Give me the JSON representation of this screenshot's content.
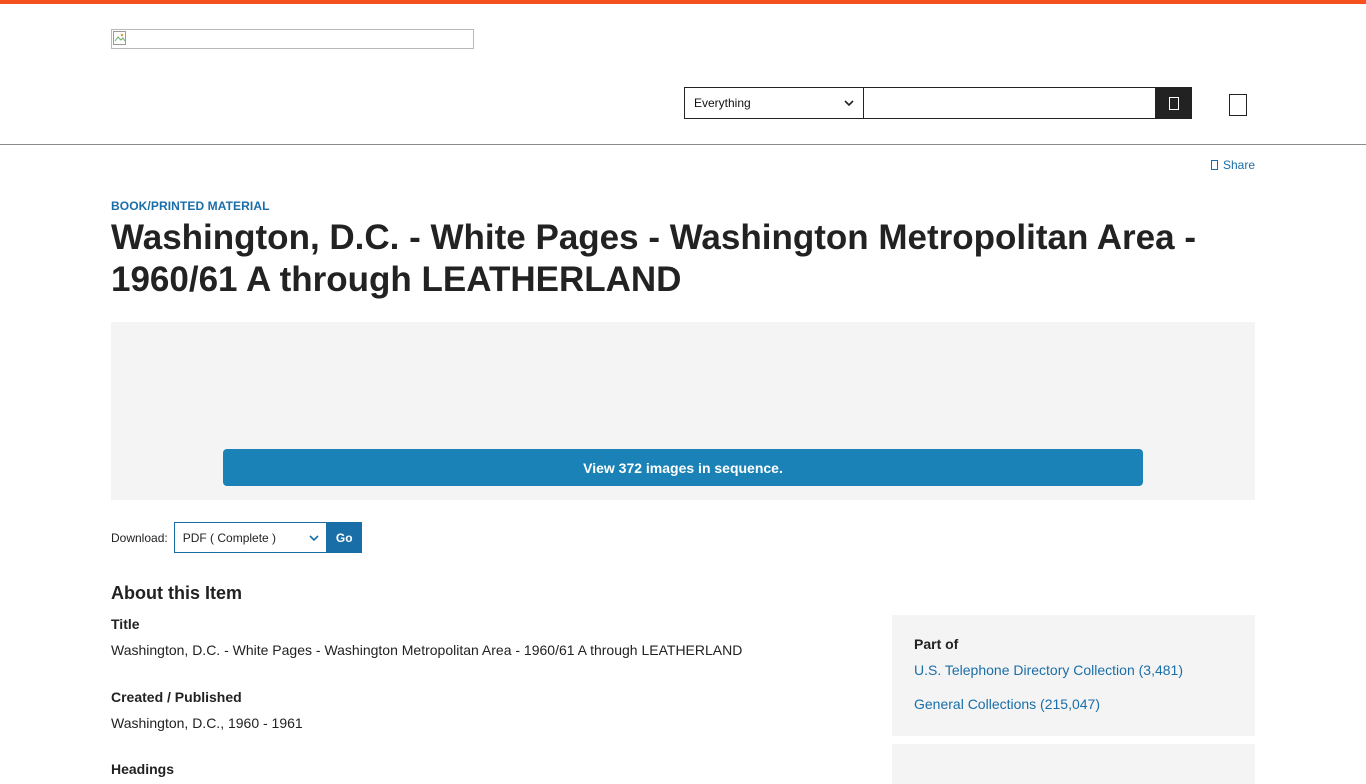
{
  "header": {
    "search": {
      "scope_selected": "Everything",
      "query": "",
      "placeholder": ""
    }
  },
  "share_label": "Share",
  "item": {
    "type_label": "BOOK/PRINTED MATERIAL",
    "title": "Washington, D.C. - White Pages - Washington Metropolitan Area - 1960/61 A through LEATHERLAND",
    "view_sequence_label": "View 372 images in sequence."
  },
  "download": {
    "label": "Download:",
    "selected_option": "PDF ( Complete )",
    "go_label": "Go"
  },
  "about": {
    "heading": "About this Item",
    "fields": [
      {
        "label": "Title",
        "value": "Washington, D.C. - White Pages - Washington Metropolitan Area - 1960/61 A through LEATHERLAND"
      },
      {
        "label": "Created / Published",
        "value": "Washington, D.C., 1960 - 1961"
      },
      {
        "label": "Headings",
        "value": ""
      }
    ]
  },
  "part_of": {
    "heading": "Part of",
    "links": [
      "U.S. Telephone Directory Collection (3,481)",
      "General Collections (215,047)"
    ]
  },
  "colors": {
    "accent_bar": "#f4511e",
    "link": "#1a6ea8",
    "primary_button": "#1a82b6",
    "panel_bg": "#f4f4f4"
  }
}
